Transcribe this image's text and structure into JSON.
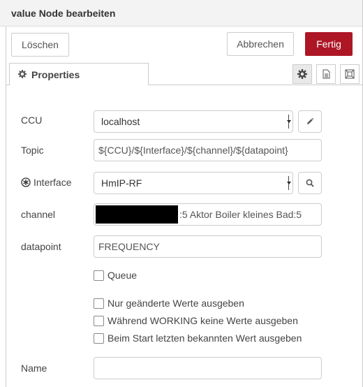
{
  "title_bar": {
    "title": "value Node bearbeiten"
  },
  "buttons": {
    "delete": "Löschen",
    "cancel": "Abbrechen",
    "done": "Fertig"
  },
  "colors": {
    "primary": "#ad1625"
  },
  "tabs": [
    {
      "label": "Properties",
      "icon": "gear-icon",
      "active": true
    }
  ],
  "toolbar_icons": [
    "gear-icon",
    "description-icon",
    "layout-icon"
  ],
  "form": {
    "ccu": {
      "label": "CCU",
      "value": "localhost",
      "edit_icon": "pencil-icon"
    },
    "topic": {
      "label": "Topic",
      "value": "${CCU}/${Interface}/${channel}/${datapoint}"
    },
    "interface": {
      "label": "Interface",
      "value": "HmIP-RF",
      "icon": "interface-icon",
      "search_icon": "search-icon"
    },
    "channel": {
      "label": "channel",
      "value_suffix": ":5 Aktor Boiler kleines Bad:5"
    },
    "datapoint": {
      "label": "datapoint",
      "value": "FREQUENCY"
    },
    "queue": {
      "label": "Queue",
      "checked": false
    },
    "options": [
      {
        "label": "Nur geänderte Werte ausgeben",
        "checked": false
      },
      {
        "label": "Während WORKING keine Werte ausgeben",
        "checked": false
      },
      {
        "label": "Beim Start letzten bekannten Wert ausgeben",
        "checked": false
      }
    ],
    "name": {
      "label": "Name",
      "value": ""
    }
  }
}
